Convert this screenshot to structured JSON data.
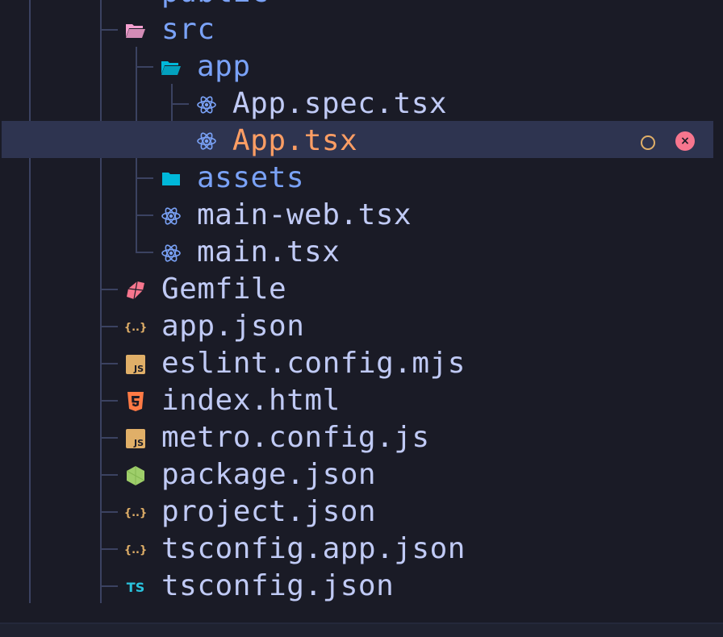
{
  "explorer": {
    "items": [
      {
        "label": "public",
        "kind": "folder",
        "icon": "folder-icon"
      },
      {
        "label": "src",
        "kind": "folder-open",
        "icon": "folder-open-icon"
      },
      {
        "label": "app",
        "kind": "folder-open",
        "icon": "folder-open-icon"
      },
      {
        "label": "App.spec.tsx",
        "kind": "file",
        "icon": "react-icon"
      },
      {
        "label": "App.tsx",
        "kind": "file",
        "icon": "react-icon",
        "selected": true,
        "modified": true
      },
      {
        "label": "assets",
        "kind": "folder",
        "icon": "folder-icon"
      },
      {
        "label": "main-web.tsx",
        "kind": "file",
        "icon": "react-icon"
      },
      {
        "label": "main.tsx",
        "kind": "file",
        "icon": "react-icon"
      },
      {
        "label": "Gemfile",
        "kind": "file",
        "icon": "ruby-icon"
      },
      {
        "label": "app.json",
        "kind": "file",
        "icon": "json-icon"
      },
      {
        "label": "eslint.config.mjs",
        "kind": "file",
        "icon": "javascript-icon"
      },
      {
        "label": "index.html",
        "kind": "file",
        "icon": "html5-icon"
      },
      {
        "label": "metro.config.js",
        "kind": "file",
        "icon": "javascript-icon"
      },
      {
        "label": "package.json",
        "kind": "file",
        "icon": "nodejs-icon"
      },
      {
        "label": "project.json",
        "kind": "file",
        "icon": "json-icon"
      },
      {
        "label": "tsconfig.app.json",
        "kind": "file",
        "icon": "json-icon"
      },
      {
        "label": "tsconfig.json",
        "kind": "file",
        "icon": "typescript-icon"
      }
    ],
    "icon_text": {
      "javascript": "JS",
      "typescript": "TS",
      "json": "{..}",
      "close": "×"
    }
  },
  "colors": {
    "background": "#1a1b26",
    "selected_row": "#2e3450",
    "folder_label": "#7aa2f7",
    "file_label": "#c0caf5",
    "active_label": "#ff9e64",
    "modified": "#e0af68",
    "close": "#f7768e",
    "react": "#7aa2f7",
    "folder_open_pink": "#f5a0d0",
    "folder_cyan": "#00b8d9"
  }
}
